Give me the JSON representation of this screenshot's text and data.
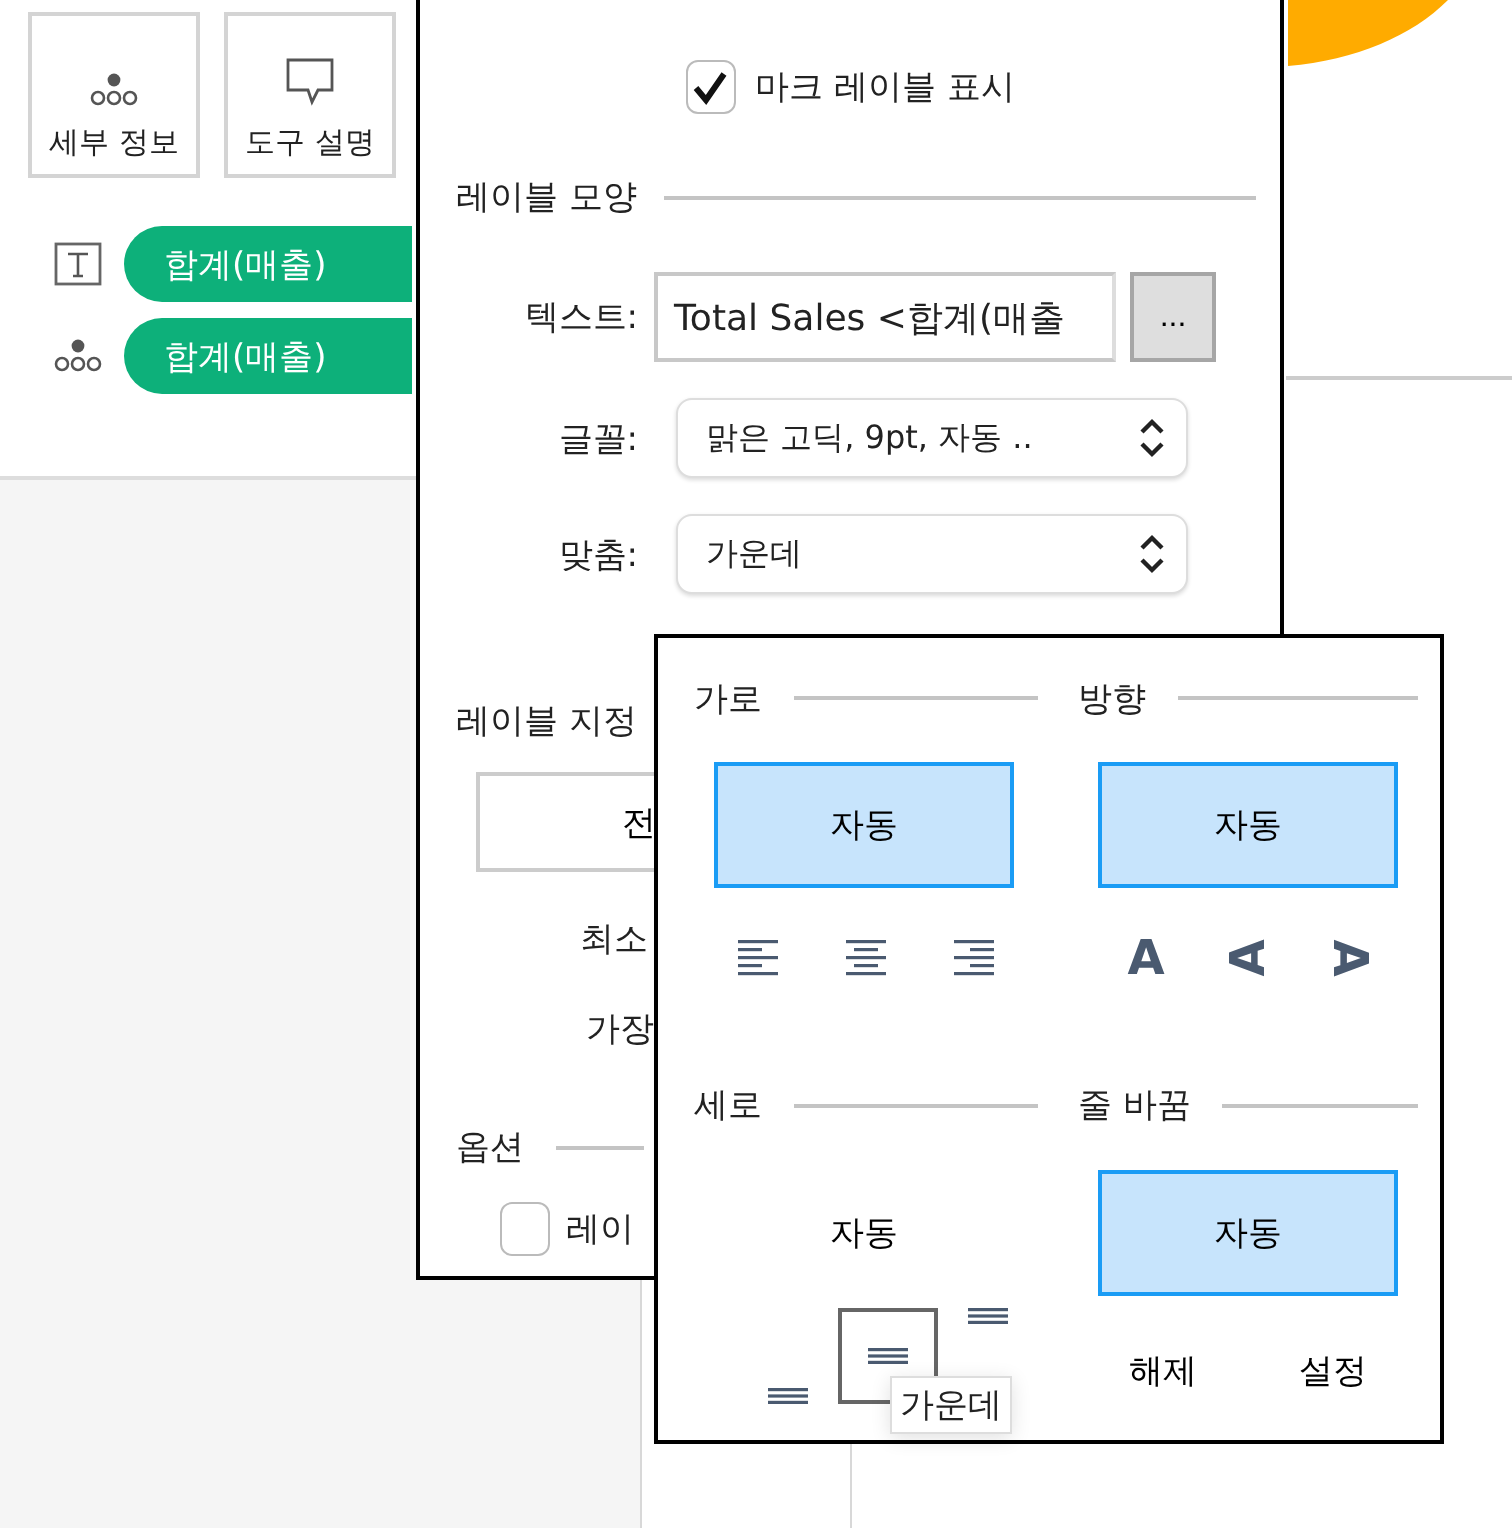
{
  "left_panel": {
    "mark_buttons": [
      {
        "kind": "detail",
        "label": "세부 정보"
      },
      {
        "kind": "tooltip",
        "label": "도구 설명"
      }
    ],
    "fields": [
      {
        "kind": "text",
        "label": "합계(매출)"
      },
      {
        "kind": "detail",
        "label": "합계(매출)"
      }
    ]
  },
  "dialog": {
    "show_labels": {
      "label": "마크 레이블 표시",
      "checked": true
    },
    "appearance": {
      "title": "레이블 모양",
      "text": {
        "label": "텍스트:",
        "value": "Total Sales <합계(매출",
        "button": "..."
      },
      "font": {
        "label": "글꼴:",
        "value": "맑은 고딕, 9pt, 자동 .."
      },
      "alignment": {
        "label": "맞춤:",
        "value": "가운데"
      }
    },
    "marks_to_label": {
      "title": "레이블 지정",
      "button": "전",
      "items": [
        "최소",
        "가장"
      ]
    },
    "options": {
      "title": "옵션",
      "checkbox": {
        "label": "레이",
        "checked": false
      }
    }
  },
  "alignment_popup": {
    "horizontal": {
      "title": "가로",
      "auto": {
        "label": "자동",
        "selected": true
      },
      "icons": [
        {
          "kind": "left",
          "selected": false
        },
        {
          "kind": "center",
          "selected": false
        },
        {
          "kind": "right",
          "selected": false
        }
      ]
    },
    "direction": {
      "title": "방향",
      "auto": {
        "label": "자동",
        "selected": true
      },
      "glyphs": [
        {
          "kind": "upright",
          "glyph": "A",
          "selected": false
        },
        {
          "kind": "rotate_left",
          "glyph": "A",
          "selected": false
        },
        {
          "kind": "rotate_right",
          "glyph": "A",
          "selected": false
        }
      ]
    },
    "vertical": {
      "title": "세로",
      "auto": {
        "label": "자동",
        "selected": false
      },
      "icons": [
        {
          "kind": "bottom",
          "selected": false,
          "hovered": false
        },
        {
          "kind": "middle",
          "selected": false,
          "hovered": true
        },
        {
          "kind": "top",
          "selected": false,
          "hovered": false
        }
      ]
    },
    "wrap": {
      "title": "줄 바꿈",
      "auto": {
        "label": "자동",
        "selected": true
      },
      "options": [
        {
          "label": "해제",
          "selected": false
        },
        {
          "label": "설정",
          "selected": false
        }
      ]
    },
    "tooltip": "가운데"
  }
}
